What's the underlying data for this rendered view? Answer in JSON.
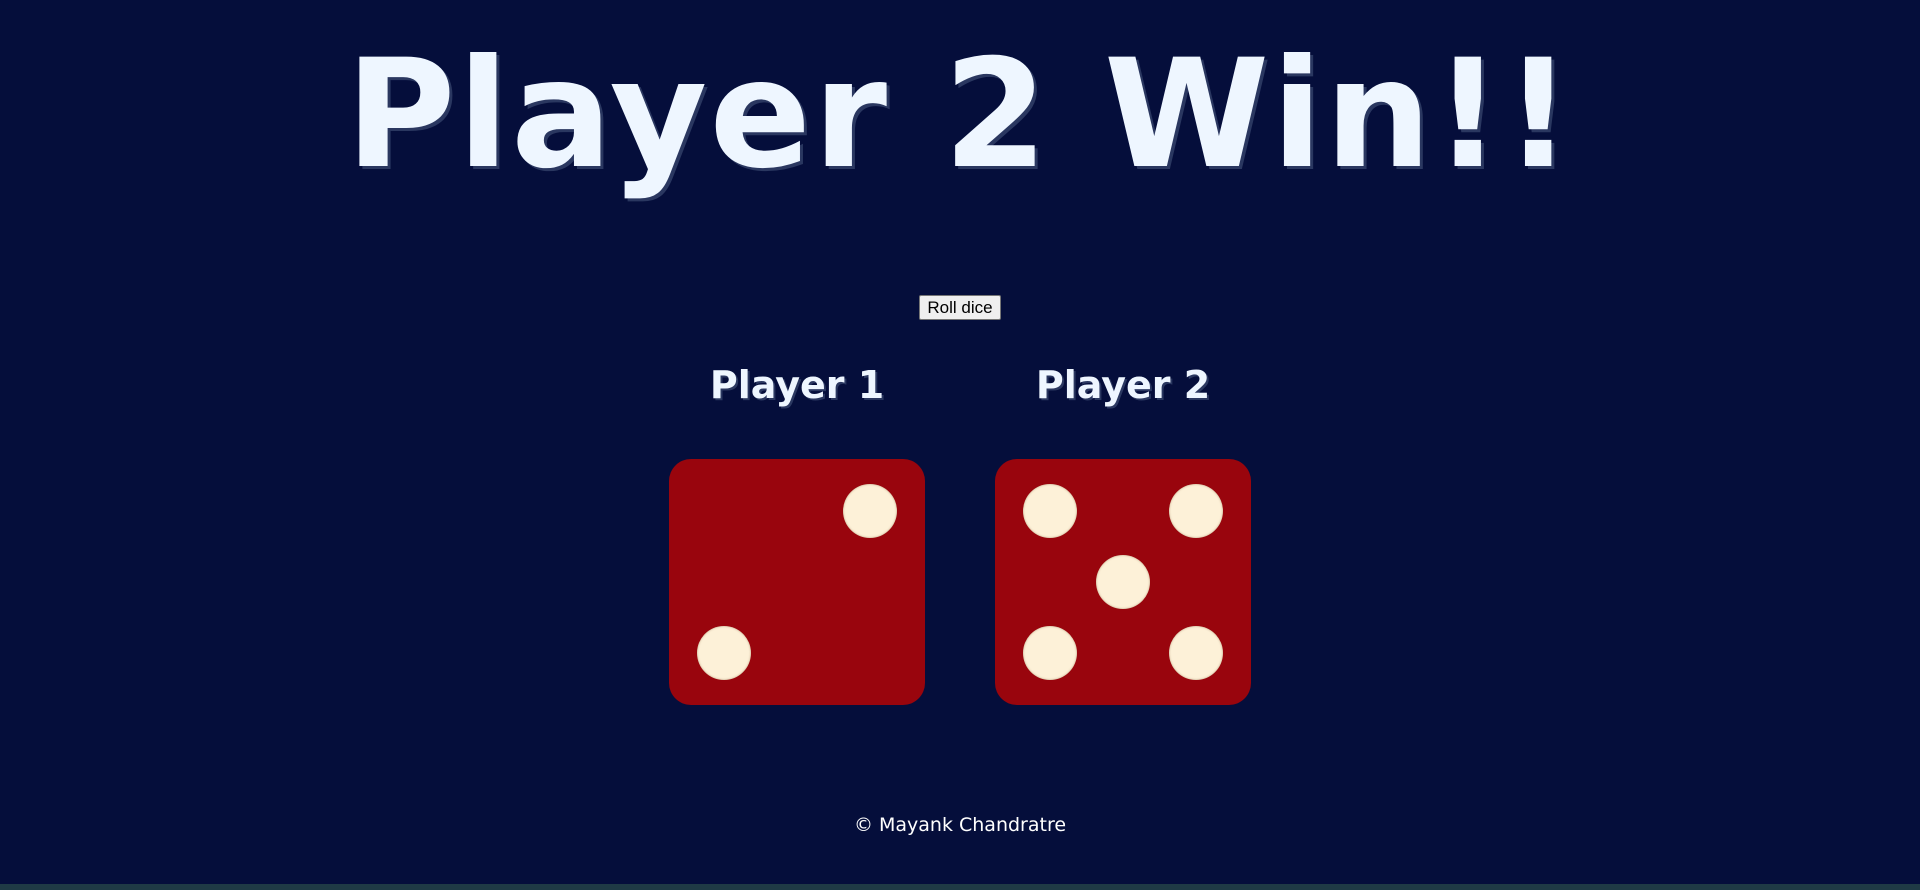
{
  "heading": "Player 2 Win!!",
  "roll_button_label": "Roll dice",
  "players": [
    {
      "label": "Player 1",
      "die_value": 2
    },
    {
      "label": "Player 2",
      "die_value": 5
    }
  ],
  "footer_text": "© Mayank Chandratre",
  "colors": {
    "background": "#050e3b",
    "die": "#99050d",
    "pip": "#fdf1d8",
    "text": "#eef6ff"
  }
}
